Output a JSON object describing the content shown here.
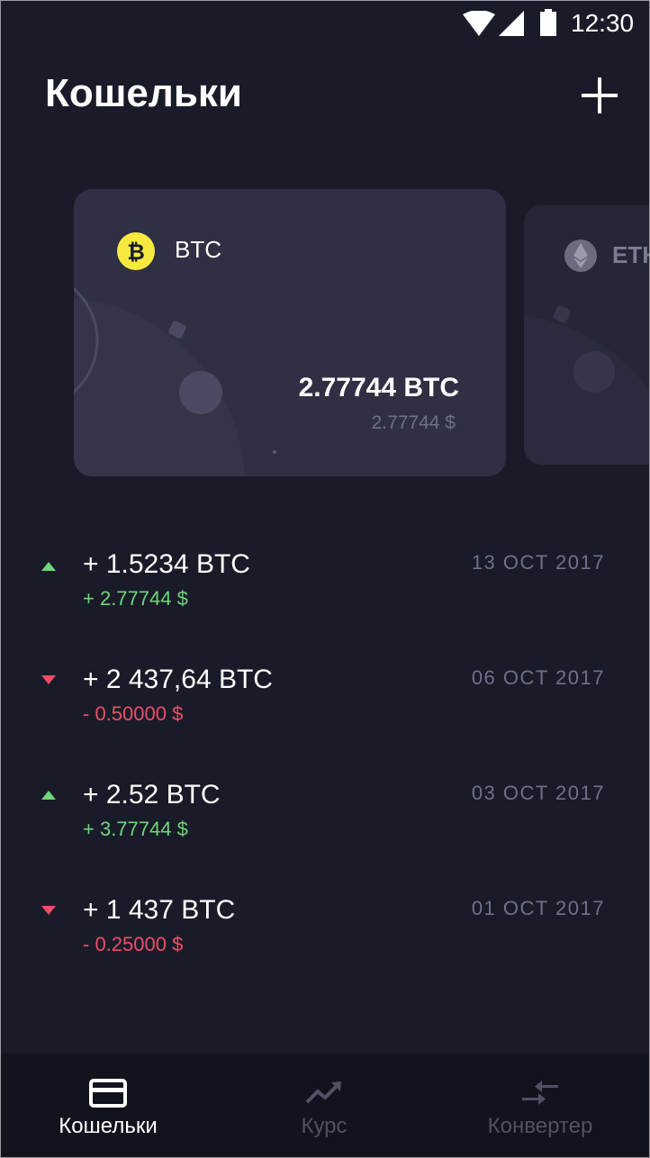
{
  "status_bar": {
    "time": "12:30",
    "icons": [
      "wifi-icon",
      "signal-icon",
      "battery-icon"
    ]
  },
  "header": {
    "title": "Кошельки",
    "add_icon": "plus-icon"
  },
  "cards": [
    {
      "symbol": "BTC",
      "icon": "bitcoin-icon",
      "icon_color": "#f7e93f",
      "balance": "2.77744 BTC",
      "balance_usd": "2.77744 $"
    },
    {
      "symbol": "ETH",
      "icon": "ethereum-icon",
      "icon_color": "#8a8b9c"
    }
  ],
  "transactions": [
    {
      "direction": "up",
      "amount": "+ 1.5234 BTC",
      "usd": "+ 2.77744 $",
      "date": "13 OCT 2017"
    },
    {
      "direction": "down",
      "amount": "+ 2 437,64 BTC",
      "usd": "- 0.50000 $",
      "date": "06 OCT 2017"
    },
    {
      "direction": "up",
      "amount": "+ 2.52 BTC",
      "usd": "+ 3.77744 $",
      "date": "03 OCT 2017"
    },
    {
      "direction": "down",
      "amount": "+ 1 437 BTC",
      "usd": "- 0.25000 $",
      "date": "01 OCT 2017"
    }
  ],
  "bottom_nav": {
    "items": [
      {
        "label": "Кошельки",
        "icon": "card-icon",
        "active": true
      },
      {
        "label": "Курс",
        "icon": "trend-up-icon",
        "active": false
      },
      {
        "label": "Конвертер",
        "icon": "exchange-arrows-icon",
        "active": false
      }
    ]
  },
  "colors": {
    "background": "#1a1b29",
    "card": "#2f3044",
    "positive": "#6fd67a",
    "negative": "#ec4e66",
    "muted": "#6f7088",
    "nav_background": "#12131d"
  }
}
